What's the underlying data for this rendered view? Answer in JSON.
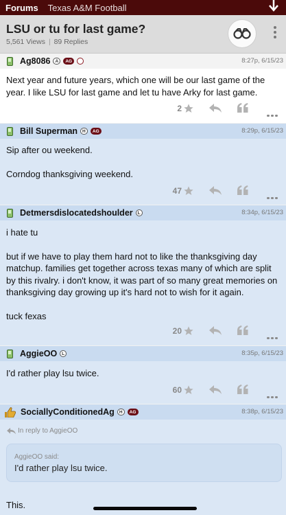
{
  "topbar": {
    "forums": "Forums",
    "crumb": "Texas A&M Football"
  },
  "thread": {
    "title": "LSU or tu for last game?",
    "views": "5,561 Views",
    "sep": "|",
    "replies": "89 Replies"
  },
  "posts": [
    {
      "username": "Ag8086",
      "badges": [
        "A",
        "AG"
      ],
      "time": "8:27p, 6/15/23",
      "paragraphs": [
        "Next year and future years, which one will be our last game of the year. I like LSU for last game and let tu have Arky for last game."
      ],
      "likes": "2"
    },
    {
      "username": "Bill Superman",
      "badges": [
        "H",
        "AG"
      ],
      "time": "8:29p, 6/15/23",
      "paragraphs": [
        "Sip after ou weekend.",
        "Corndog thanksgiving weekend."
      ],
      "likes": "47"
    },
    {
      "username": "Detmersdislocatedshoulder",
      "badges": [
        "L"
      ],
      "time": "8:34p, 6/15/23",
      "paragraphs": [
        "i hate tu",
        "but if we have to play them hard not to like the thanksgiving day matchup. families get together across texas many of which are split by this rivalry. i don't know, it was part of so many great memories on thanksgiving day growing up it's hard not to wish for it again.",
        "tuck fexas"
      ],
      "likes": "20"
    },
    {
      "username": "AggieOO",
      "badges": [
        "L"
      ],
      "time": "8:35p, 6/15/23",
      "paragraphs": [
        "I'd rather play lsu twice."
      ],
      "likes": "60"
    },
    {
      "username": "SociallyConditionedAg",
      "badges": [
        "H",
        "AG"
      ],
      "time": "8:38p, 6/15/23",
      "reply_to": "In reply to AggieOO",
      "quote_header": "AggieOO said:",
      "quote_text": "I'd rather play lsu twice.",
      "paragraphs": [
        "This."
      ]
    }
  ],
  "colors": {
    "maroon": "#4b0a0a",
    "post_blue": "#dbe7f5",
    "post_header_blue": "#c9dbf0"
  }
}
